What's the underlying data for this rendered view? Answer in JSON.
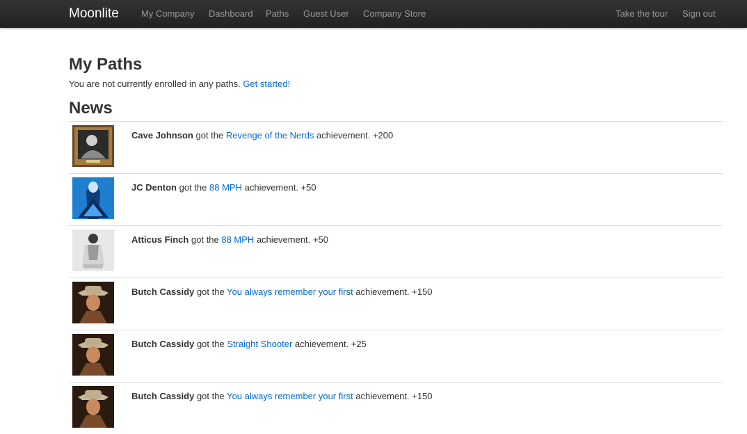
{
  "nav": {
    "brand": "Moonlite",
    "links": [
      "My Company",
      "Dashboard",
      "Paths",
      "Guest User",
      "Company Store"
    ],
    "right_links": [
      "Take the tour",
      "Sign out"
    ]
  },
  "my_paths": {
    "title": "My Paths",
    "text": "You are not currently enrolled in any paths.",
    "link": "Get started!"
  },
  "news": {
    "title": "News",
    "items": [
      {
        "user": "Cave Johnson",
        "got": "got the",
        "achievement": "Revenge of the Nerds",
        "suffix": "achievement. +200",
        "avatar": "framed-portrait"
      },
      {
        "user": "JC Denton",
        "got": "got the",
        "achievement": "88 MPH",
        "suffix": "achievement. +50",
        "avatar": "blue-figure"
      },
      {
        "user": "Atticus Finch",
        "got": "got the",
        "achievement": "88 MPH",
        "suffix": "achievement. +50",
        "avatar": "bw-portrait"
      },
      {
        "user": "Butch Cassidy",
        "got": "got the",
        "achievement": "You always remember your first",
        "suffix": "achievement. +150",
        "avatar": "cowboy-portrait"
      },
      {
        "user": "Butch Cassidy",
        "got": "got the",
        "achievement": "Straight Shooter",
        "suffix": "achievement. +25",
        "avatar": "cowboy-portrait"
      },
      {
        "user": "Butch Cassidy",
        "got": "got the",
        "achievement": "You always remember your first",
        "suffix": "achievement. +150",
        "avatar": "cowboy-portrait"
      }
    ]
  },
  "colors": {
    "navbar": "#222222",
    "link": "#0069d6",
    "text": "#333333",
    "divider": "#dddddd"
  }
}
